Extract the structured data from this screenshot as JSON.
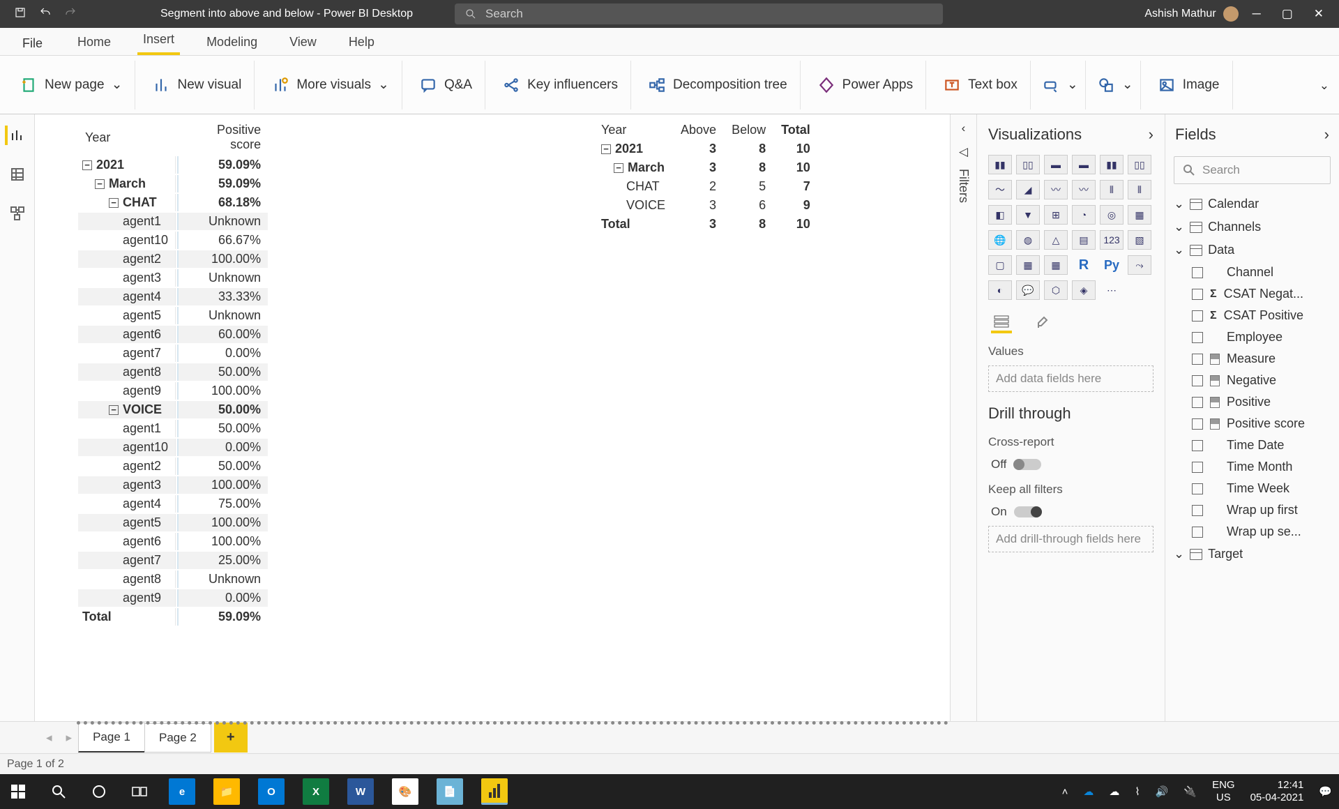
{
  "titlebar": {
    "title": "Segment into above and below - Power BI Desktop",
    "search_placeholder": "Search",
    "user_name": "Ashish Mathur"
  },
  "ribbon_tabs": {
    "file": "File",
    "tabs": [
      "Home",
      "Insert",
      "Modeling",
      "View",
      "Help"
    ],
    "active": "Insert"
  },
  "ribbon_buttons": {
    "new_page": "New page",
    "new_visual": "New visual",
    "more_visuals": "More visuals",
    "qa": "Q&A",
    "key_influencers": "Key influencers",
    "decomposition": "Decomposition tree",
    "power_apps": "Power Apps",
    "text_box": "Text box",
    "image": "Image"
  },
  "matrix1": {
    "headers": {
      "year": "Year",
      "score": "Positive score"
    },
    "rows": [
      {
        "label": "2021",
        "score": "59.09%",
        "group": true,
        "indent": 0,
        "expand": true
      },
      {
        "label": "March",
        "score": "59.09%",
        "group": true,
        "indent": 1,
        "expand": true
      },
      {
        "label": "CHAT",
        "score": "68.18%",
        "group": true,
        "indent": 2,
        "expand": true
      },
      {
        "label": "agent1",
        "score": "Unknown",
        "indent": 3,
        "alt": true
      },
      {
        "label": "agent10",
        "score": "66.67%",
        "indent": 3
      },
      {
        "label": "agent2",
        "score": "100.00%",
        "indent": 3,
        "alt": true
      },
      {
        "label": "agent3",
        "score": "Unknown",
        "indent": 3
      },
      {
        "label": "agent4",
        "score": "33.33%",
        "indent": 3,
        "alt": true
      },
      {
        "label": "agent5",
        "score": "Unknown",
        "indent": 3
      },
      {
        "label": "agent6",
        "score": "60.00%",
        "indent": 3,
        "alt": true
      },
      {
        "label": "agent7",
        "score": "0.00%",
        "indent": 3
      },
      {
        "label": "agent8",
        "score": "50.00%",
        "indent": 3,
        "alt": true
      },
      {
        "label": "agent9",
        "score": "100.00%",
        "indent": 3
      },
      {
        "label": "VOICE",
        "score": "50.00%",
        "group": true,
        "indent": 2,
        "expand": true,
        "alt": true
      },
      {
        "label": "agent1",
        "score": "50.00%",
        "indent": 3
      },
      {
        "label": "agent10",
        "score": "0.00%",
        "indent": 3,
        "alt": true
      },
      {
        "label": "agent2",
        "score": "50.00%",
        "indent": 3
      },
      {
        "label": "agent3",
        "score": "100.00%",
        "indent": 3,
        "alt": true
      },
      {
        "label": "agent4",
        "score": "75.00%",
        "indent": 3
      },
      {
        "label": "agent5",
        "score": "100.00%",
        "indent": 3,
        "alt": true
      },
      {
        "label": "agent6",
        "score": "100.00%",
        "indent": 3
      },
      {
        "label": "agent7",
        "score": "25.00%",
        "indent": 3,
        "alt": true
      },
      {
        "label": "agent8",
        "score": "Unknown",
        "indent": 3
      },
      {
        "label": "agent9",
        "score": "0.00%",
        "indent": 3,
        "alt": true
      },
      {
        "label": "Total",
        "score": "59.09%",
        "group": true,
        "indent": 0
      }
    ]
  },
  "matrix2": {
    "headers": {
      "year": "Year",
      "above": "Above",
      "below": "Below",
      "total": "Total"
    },
    "rows": [
      {
        "label": "2021",
        "above": "3",
        "below": "8",
        "total": "10",
        "bold": true,
        "expand": true,
        "indent": 0
      },
      {
        "label": "March",
        "above": "3",
        "below": "8",
        "total": "10",
        "bold": true,
        "expand": true,
        "indent": 1
      },
      {
        "label": "CHAT",
        "above": "2",
        "below": "5",
        "total": "7",
        "indent": 2
      },
      {
        "label": "VOICE",
        "above": "3",
        "below": "6",
        "total": "9",
        "indent": 2
      },
      {
        "label": "Total",
        "above": "3",
        "below": "8",
        "total": "10",
        "bold": true,
        "indent": 0
      }
    ]
  },
  "filters_label": "Filters",
  "viz": {
    "title": "Visualizations",
    "values_label": "Values",
    "values_placeholder": "Add data fields here",
    "drill_title": "Drill through",
    "cross_report": "Cross-report",
    "cross_report_state": "Off",
    "keep_filters": "Keep all filters",
    "keep_filters_state": "On",
    "drill_placeholder": "Add drill-through fields here"
  },
  "fields": {
    "title": "Fields",
    "search_placeholder": "Search",
    "groups": [
      {
        "name": "Calendar",
        "expanded": false
      },
      {
        "name": "Channels",
        "expanded": false
      },
      {
        "name": "Data",
        "expanded": true,
        "items": [
          {
            "name": "Channel",
            "type": "col"
          },
          {
            "name": "CSAT Negat...",
            "type": "sum"
          },
          {
            "name": "CSAT Positive",
            "type": "sum"
          },
          {
            "name": "Employee",
            "type": "col"
          },
          {
            "name": "Measure",
            "type": "measure"
          },
          {
            "name": "Negative",
            "type": "measure"
          },
          {
            "name": "Positive",
            "type": "measure"
          },
          {
            "name": "Positive score",
            "type": "measure"
          },
          {
            "name": "Time Date",
            "type": "col"
          },
          {
            "name": "Time Month",
            "type": "col"
          },
          {
            "name": "Time Week",
            "type": "col"
          },
          {
            "name": "Wrap up first",
            "type": "col"
          },
          {
            "name": "Wrap up se...",
            "type": "col"
          }
        ]
      },
      {
        "name": "Target",
        "expanded": false
      }
    ]
  },
  "pages": {
    "tabs": [
      "Page 1",
      "Page 2"
    ],
    "active": "Page 1"
  },
  "status": "Page 1 of 2",
  "taskbar": {
    "lang1": "ENG",
    "lang2": "US",
    "time": "12:41",
    "date": "05-04-2021"
  }
}
